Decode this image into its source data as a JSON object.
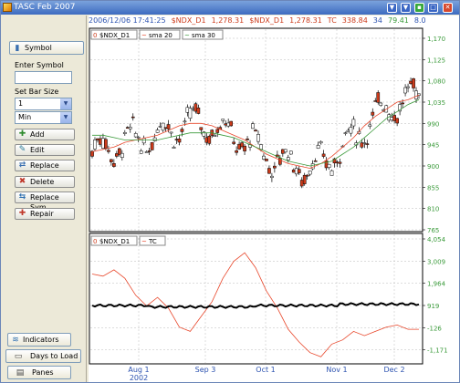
{
  "window": {
    "title": "TASC Feb 2007"
  },
  "titlebar_buttons": [
    "chevron-down",
    "chevron-down",
    "restore",
    "maximize",
    "close"
  ],
  "sidebar": {
    "symbol_button": "Symbol",
    "enter_symbol_label": "Enter Symbol",
    "symbol_value": "",
    "bar_size_label": "Set Bar Size",
    "bar_size_value": "1",
    "bar_unit_value": "Min",
    "actions": [
      {
        "label": "Add",
        "icon": "plus-icon",
        "color": "#2e8b2e"
      },
      {
        "label": "Edit",
        "icon": "edit-icon",
        "color": "#2e7d9a"
      },
      {
        "label": "Replace",
        "icon": "replace-icon",
        "color": "#3a6fb0"
      },
      {
        "label": "Delete",
        "icon": "delete-icon",
        "color": "#c0392b"
      },
      {
        "label": "Replace Sym",
        "icon": "replace-sym-icon",
        "color": "#2e6fb0"
      },
      {
        "label": "Repair",
        "icon": "repair-icon",
        "color": "#c0392b"
      }
    ],
    "bottom_buttons": [
      {
        "label": "Indicators",
        "icon": "indicators-icon"
      },
      {
        "label": "Days to Load",
        "icon": "days-icon"
      },
      {
        "label": "Panes",
        "icon": "panes-icon"
      }
    ]
  },
  "infobar": {
    "date": "2006/12/06 17:41:25",
    "sym1": "$NDX_D1",
    "val1": "1,278.31",
    "sym2": "$NDX_D1",
    "val2": "1,278.31",
    "tc": "TC",
    "tc_val": "338.84",
    "v34": "34",
    "v79": "79.41",
    "v8": "8.0"
  },
  "upper_pane": {
    "legend": [
      "$NDX_D1",
      "sma 20",
      "sma 30"
    ],
    "legend_markers": [
      "0",
      "~",
      "~"
    ],
    "y_ticks": [
      "1,170",
      "1,125",
      "1,080",
      "1,035",
      "990",
      "945",
      "900",
      "855",
      "810",
      "765"
    ]
  },
  "lower_pane": {
    "legend": [
      "$NDX_D1",
      "TC"
    ],
    "legend_markers": [
      "0",
      "~"
    ],
    "y_ticks": [
      "4,054",
      "3,009",
      "1,964",
      "919",
      "-126",
      "-1,171"
    ]
  },
  "x_axis": {
    "labels": [
      "Aug 1",
      "Sep 3",
      "Oct 1",
      "Nov 1",
      "Dec 2"
    ],
    "year_label": "2002"
  },
  "colors": {
    "accent": "#2d53b0",
    "up_candle": "#ffffff",
    "down_candle": "#cc3b1b",
    "sma20": "#e8462a",
    "sma30": "#3a9a3a",
    "tc_line": "#e8462a",
    "zero_line": "#000000",
    "y_tick_upper": "#3a9a3a",
    "y_tick_lower": "#3a9a3a"
  },
  "chart_data": [
    {
      "type": "candlestick",
      "title": "$NDX_D1",
      "x_labels": [
        "Aug 1",
        "Sep 3",
        "Oct 1",
        "Nov 1",
        "Dec 2"
      ],
      "ylim": [
        765,
        1170
      ],
      "series": [
        {
          "name": "sma 20",
          "values": [
            930,
            935,
            940,
            950,
            955,
            960,
            965,
            975,
            985,
            990,
            990,
            985,
            975,
            965,
            955,
            940,
            925,
            915,
            905,
            900,
            895,
            905,
            920,
            940,
            960,
            985,
            1005,
            1020,
            1035,
            1040,
            1050
          ]
        },
        {
          "name": "sma 30",
          "values": [
            965,
            965,
            960,
            955,
            955,
            955,
            955,
            960,
            965,
            970,
            970,
            970,
            965,
            960,
            950,
            940,
            930,
            920,
            910,
            905,
            900,
            905,
            910,
            925,
            940,
            960,
            980,
            1000,
            1015,
            1030,
            1040
          ]
        }
      ]
    },
    {
      "type": "line",
      "title": "TC",
      "x_labels": [
        "Aug 1",
        "Sep 3",
        "Oct 1",
        "Nov 1",
        "Dec 2"
      ],
      "ylim": [
        -1700,
        4054
      ],
      "series": [
        {
          "name": "TC",
          "values": [
            2400,
            2300,
            2600,
            2200,
            1400,
            900,
            1300,
            800,
            -100,
            -300,
            400,
            1100,
            2200,
            3000,
            3400,
            2700,
            1600,
            800,
            -200,
            -800,
            -1300,
            -1500,
            -900,
            -700,
            -300,
            -500,
            -300,
            -100,
            0,
            -200,
            -200
          ]
        }
      ]
    }
  ]
}
